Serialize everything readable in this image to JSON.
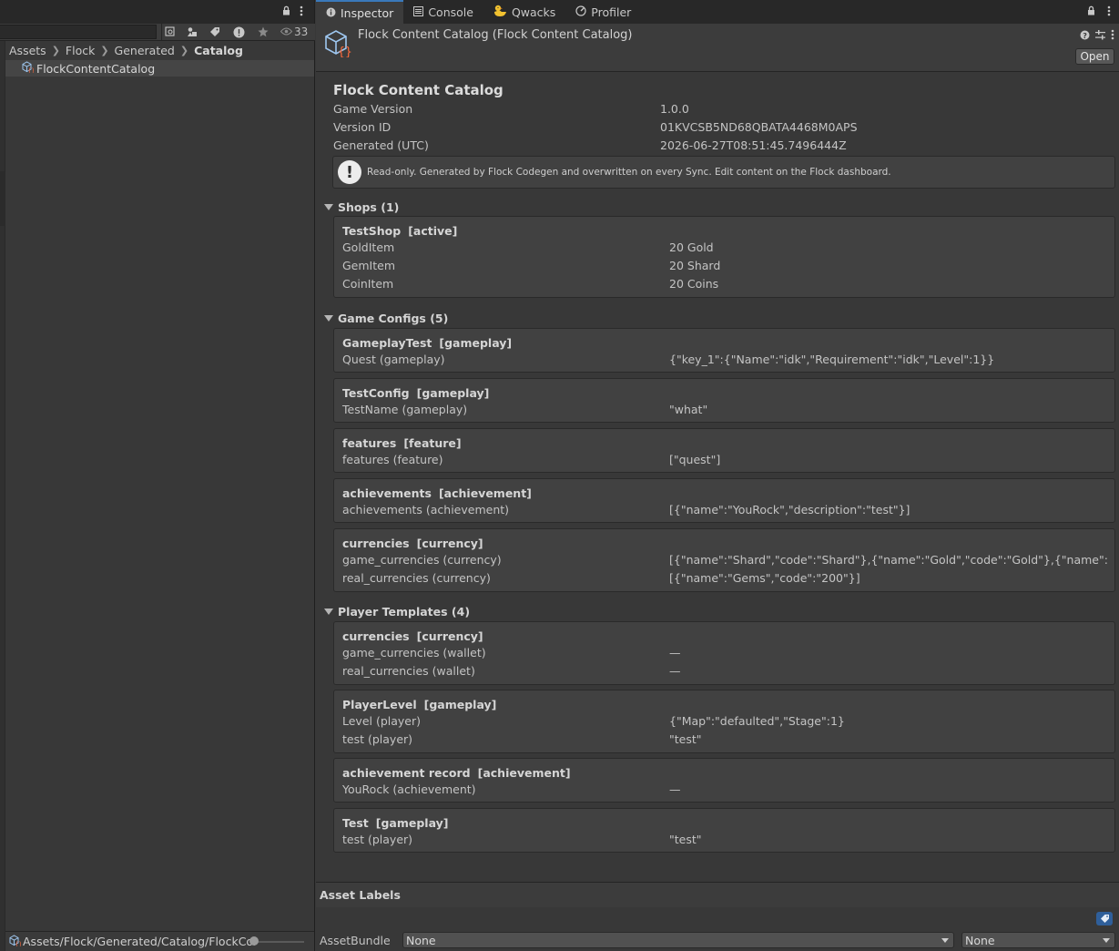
{
  "project": {
    "hidden_count": "33",
    "breadcrumbs": [
      "Assets",
      "Flock",
      "Generated",
      "Catalog"
    ],
    "selected_asset": "FlockContentCatalog",
    "status_path": "Assets/Flock/Generated/Catalog/FlockContentCatalog.asset"
  },
  "tabs": [
    {
      "label": "Inspector",
      "icon": "info-icon"
    },
    {
      "label": "Console",
      "icon": "console-icon"
    },
    {
      "label": "Qwacks",
      "icon": "duck-icon"
    },
    {
      "label": "Profiler",
      "icon": "profiler-icon"
    }
  ],
  "inspector": {
    "object_title": "Flock Content Catalog (Flock Content Catalog)",
    "open_label": "Open",
    "heading": "Flock Content Catalog",
    "meta": [
      {
        "key": "Game Version",
        "value": "1.0.0"
      },
      {
        "key": "Version ID",
        "value": "01KVCSB5ND68QBATA4468M0APS"
      },
      {
        "key": "Generated (UTC)",
        "value": "2026-06-27T08:51:45.7496444Z"
      }
    ],
    "help_text": "Read-only. Generated by Flock Codegen and overwritten on every Sync. Edit content on the Flock dashboard."
  },
  "shops": {
    "header": "Shops (1)",
    "cards": [
      {
        "name": "TestShop",
        "tag": "[active]",
        "rows": [
          {
            "k": "GoldItem",
            "v": "20 Gold"
          },
          {
            "k": "GemItem",
            "v": "20 Shard"
          },
          {
            "k": "CoinItem",
            "v": "20 Coins"
          }
        ]
      }
    ]
  },
  "game_configs": {
    "header": "Game Configs (5)",
    "cards": [
      {
        "name": "GameplayTest",
        "tag": "[gameplay]",
        "rows": [
          {
            "k": "Quest  (gameplay)",
            "v": "{\"key_1\":{\"Name\":\"idk\",\"Requirement\":\"idk\",\"Level\":1}}"
          }
        ]
      },
      {
        "name": "TestConfig",
        "tag": "[gameplay]",
        "rows": [
          {
            "k": "TestName  (gameplay)",
            "v": "\"what\""
          }
        ]
      },
      {
        "name": "features",
        "tag": "[feature]",
        "rows": [
          {
            "k": "features  (feature)",
            "v": "[\"quest\"]"
          }
        ]
      },
      {
        "name": "achievements",
        "tag": "[achievement]",
        "rows": [
          {
            "k": "achievements  (achievement)",
            "v": "[{\"name\":\"YouRock\",\"description\":\"test\"}]"
          }
        ]
      },
      {
        "name": "currencies",
        "tag": "[currency]",
        "rows": [
          {
            "k": "game_currencies  (currency)",
            "v": "[{\"name\":\"Shard\",\"code\":\"Shard\"},{\"name\":\"Gold\",\"code\":\"Gold\"},{\"name\":\"Coins\",\"code\":\"Coins\"}]"
          },
          {
            "k": "real_currencies  (currency)",
            "v": "[{\"name\":\"Gems\",\"code\":\"200\"}]"
          }
        ]
      }
    ]
  },
  "player_templates": {
    "header": "Player Templates (4)",
    "cards": [
      {
        "name": "currencies",
        "tag": "[currency]",
        "rows": [
          {
            "k": "game_currencies  (wallet)",
            "v": "—"
          },
          {
            "k": "real_currencies  (wallet)",
            "v": "—"
          }
        ]
      },
      {
        "name": "PlayerLevel",
        "tag": "[gameplay]",
        "rows": [
          {
            "k": "Level  (player)",
            "v": "{\"Map\":\"defaulted\",\"Stage\":1}"
          },
          {
            "k": "test  (player)",
            "v": "\"test\""
          }
        ]
      },
      {
        "name": "achievement record",
        "tag": "[achievement]",
        "rows": [
          {
            "k": "YouRock  (achievement)",
            "v": "—"
          }
        ]
      },
      {
        "name": "Test",
        "tag": "[gameplay]",
        "rows": [
          {
            "k": "test  (player)",
            "v": "\"test\""
          }
        ]
      }
    ]
  },
  "asset_labels": {
    "header": "Asset Labels",
    "bundle_label": "AssetBundle",
    "bundle_value": "None",
    "variant_value": "None"
  },
  "colors": {
    "accent": "#3a79bb",
    "panel": "#383838",
    "card": "#414141"
  }
}
